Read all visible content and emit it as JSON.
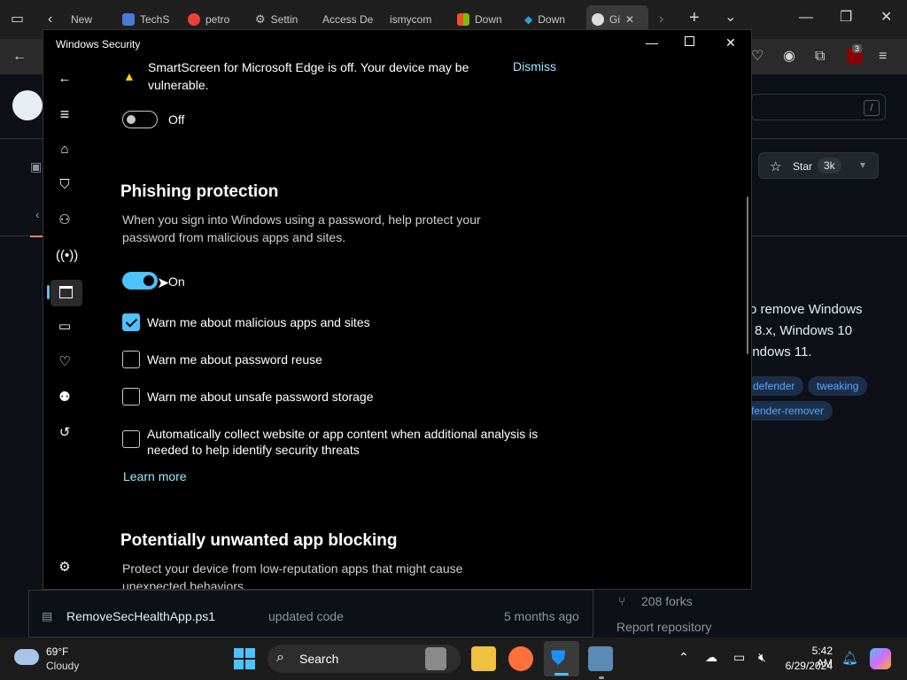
{
  "browser": {
    "tabs": [
      {
        "label": "New",
        "color": "#555"
      },
      {
        "label": "TechS",
        "color": "#4a7bd6"
      },
      {
        "label": "petro",
        "color": "#ea4335"
      },
      {
        "label": "Settin",
        "color": "#888"
      },
      {
        "label": "Access De",
        "color": "#333"
      },
      {
        "label": "ismycom",
        "color": "#333"
      },
      {
        "label": "Down",
        "color": "#f25022"
      },
      {
        "label": "Down",
        "color": "#2aa3d8"
      },
      {
        "label": "Gi",
        "color": "#888"
      }
    ],
    "extension_badge": "3"
  },
  "github": {
    "search_shortcut": "/",
    "star_label": "Star",
    "star_count": "3k",
    "description_lines": [
      "o remove Windows",
      "8.x, Windows 10",
      "indows 11."
    ],
    "topics": [
      "defender",
      "tweaking",
      "fender-remover"
    ],
    "file_row": {
      "name": "RemoveSecHealthApp.ps1",
      "message": "updated code",
      "time": "5 months ago"
    },
    "forks": "208 forks",
    "report": "Report repository"
  },
  "security_window": {
    "title": "Windows Security",
    "warning": {
      "line1": "SmartScreen for Microsoft Edge is off. Your device may be",
      "line2": "vulnerable.",
      "dismiss": "Dismiss"
    },
    "edge_toggle_label": "Off",
    "phishing": {
      "heading": "Phishing protection",
      "desc_line1": "When you sign into Windows using a password, help protect your",
      "desc_line2": "password from malicious apps and sites.",
      "toggle_label": "On",
      "options": [
        {
          "label": "Warn me about malicious apps and sites",
          "checked": true
        },
        {
          "label": "Warn me about password reuse",
          "checked": false
        },
        {
          "label": "Warn me about unsafe password storage",
          "checked": false
        }
      ],
      "collect_line1": "Automatically collect website or app content when additional analysis is",
      "collect_line2": "needed to help identify security threats",
      "learn_more": "Learn more"
    },
    "pua": {
      "heading": "Potentially unwanted app blocking",
      "desc_line1": "Protect your device from low-reputation apps that might cause",
      "desc_line2": "unexpected behaviors."
    }
  },
  "taskbar": {
    "weather_temp": "69°F",
    "weather_desc": "Cloudy",
    "search_label": "Search",
    "time": "5:42 AM",
    "date": "6/29/2024"
  }
}
